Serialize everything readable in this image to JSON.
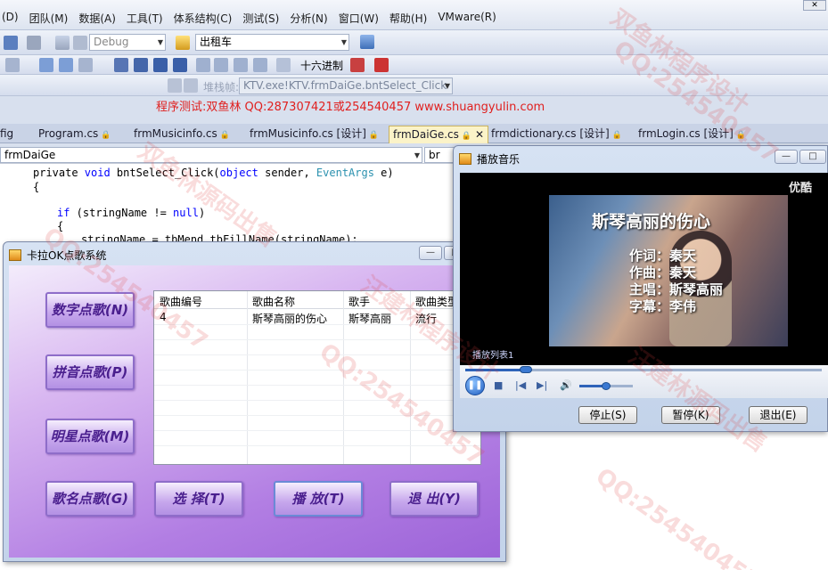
{
  "ide": {
    "menu": [
      "团队(M)",
      "数据(A)",
      "工具(T)",
      "体系结构(C)",
      "测试(S)",
      "分析(N)",
      "窗口(W)",
      "帮助(H)",
      "VMware(R)"
    ],
    "menu_first_partial": "(D)",
    "config_combo": "Debug",
    "target_combo": "出租车",
    "hex_button": "十六进制",
    "stack_label": "堆栈帧:",
    "stack_combo": "KTV.exe!KTV.frmDaiGe.bntSelect_Click",
    "banner": "程序测试:双鱼林 QQ:287307421或254540457 www.shuangyulin.com",
    "tabs": [
      {
        "label": "fig"
      },
      {
        "label": "Program.cs"
      },
      {
        "label": "frmMusicinfo.cs"
      },
      {
        "label": "frmMusicinfo.cs [设计]"
      },
      {
        "label": "frmDaiGe.cs"
      },
      {
        "label": "frmdictionary.cs [设计]"
      },
      {
        "label": "frmLogin.cs [设计]"
      }
    ],
    "member_combo": "frmDaiGe",
    "member_combo2": "br",
    "code": {
      "line1_a": "private ",
      "line1_kw": "void",
      "line1_b": " bntSelect_Click(",
      "line1_kw2": "object",
      "line1_c": " sender, ",
      "line1_ty": "EventArgs",
      "line1_d": " e)",
      "line2": "{",
      "line3_kw": "if",
      "line3_a": " (stringName != ",
      "line3_kw2": "null",
      "line3_b": ")",
      "line4": "{",
      "line5": "stringName = tbMend.tbFillName(stringName);"
    }
  },
  "karaoke": {
    "title": "卡拉OK点歌系统",
    "buttons": {
      "number": "数字点歌(N)",
      "pinyin": "拼音点歌(P)",
      "star": "明星点歌(M)",
      "name": "歌名点歌(G)",
      "select": "选 择(T)",
      "play": "播 放(T)",
      "exit": "退 出(Y)"
    },
    "grid": {
      "headers": [
        "歌曲编号",
        "歌曲名称",
        "歌手",
        "歌曲类型"
      ],
      "rows": [
        [
          "4",
          "斯琴高丽的伤心",
          "斯琴高丽",
          "流行"
        ]
      ]
    }
  },
  "player": {
    "title": "播放音乐",
    "video_title": "斯琴高丽的伤心",
    "credit_lyric": "作词：秦天",
    "credit_music": "作曲：秦天",
    "credit_singer": "主唱：斯琴高丽",
    "credit_subs": "字幕：李伟",
    "logo": "优酷",
    "playlist": "播放列表1",
    "seek_progress": 0.17,
    "volume_level": 0.5,
    "buttons": {
      "stop": "停止(S)",
      "pause": "暂停(K)",
      "exit": "退出(E)"
    }
  },
  "watermarks": [
    "QQ:254540457",
    "双鱼林源码出售",
    "汪建林程序设计",
    "QQ:254540457",
    "汪建林源码出售",
    "QQ:254540457",
    "双鱼林程序设计",
    "QQ:254540457"
  ],
  "colors": {
    "banner_red": "#e0201f",
    "karaoke_purple": "#b27ee3",
    "button_text": "#4a1f8e",
    "keyword_blue": "#0000ff",
    "type_teal": "#2b91af"
  }
}
